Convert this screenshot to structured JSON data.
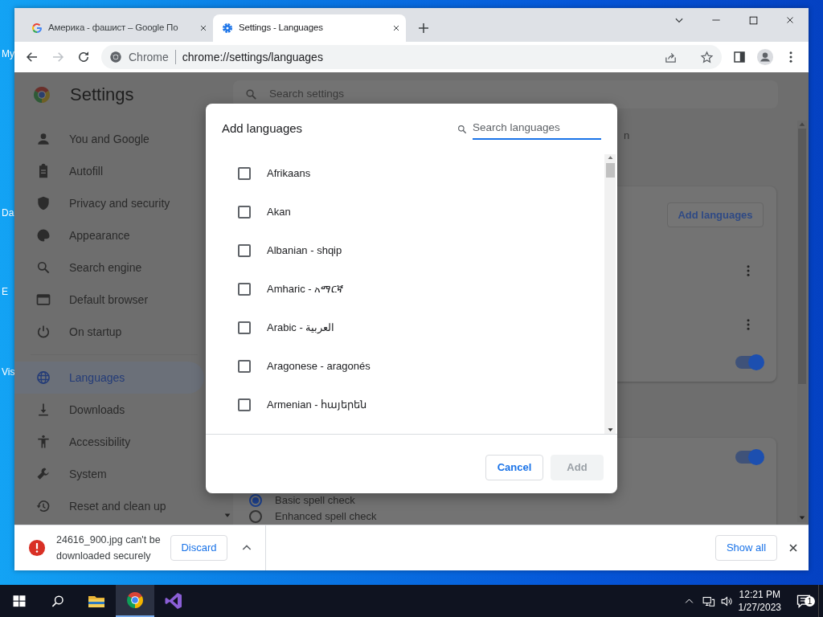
{
  "desktop": {
    "icon_labels": [
      "My",
      "Da",
      "E",
      "Vis"
    ]
  },
  "browser": {
    "tabs": [
      {
        "title": "Америка - фашист – Google По",
        "selected": false
      },
      {
        "title": "Settings - Languages",
        "selected": true
      }
    ],
    "site_chip": "Chrome",
    "url": "chrome://settings/languages"
  },
  "settings": {
    "title": "Settings",
    "search_placeholder": "Search settings",
    "nav_groups": [
      [
        {
          "label": "You and Google",
          "selected": false
        },
        {
          "label": "Autofill",
          "selected": false
        },
        {
          "label": "Privacy and security",
          "selected": false
        },
        {
          "label": "Appearance",
          "selected": false
        },
        {
          "label": "Search engine",
          "selected": false
        },
        {
          "label": "Default browser",
          "selected": false
        },
        {
          "label": "On startup",
          "selected": false
        }
      ],
      [
        {
          "label": "Languages",
          "selected": true
        },
        {
          "label": "Downloads",
          "selected": false
        },
        {
          "label": "Accessibility",
          "selected": false
        },
        {
          "label": "System",
          "selected": false
        },
        {
          "label": "Reset and clean up",
          "selected": false
        }
      ]
    ],
    "fragment": "n",
    "add_languages": "Add languages",
    "toggles": [
      {
        "on": true
      },
      {
        "on": true
      }
    ],
    "spell_check": [
      {
        "label": "Basic spell check",
        "selected": true
      },
      {
        "label": "Enhanced spell check",
        "selected": false
      }
    ]
  },
  "dialog": {
    "title": "Add languages",
    "search_placeholder": "Search languages",
    "languages": [
      {
        "label": "Afrikaans",
        "checked": false
      },
      {
        "label": "Akan",
        "checked": false
      },
      {
        "label": "Albanian - shqip",
        "checked": false
      },
      {
        "label": "Amharic - አማርኛ",
        "checked": false
      },
      {
        "label": "Arabic - العربية",
        "checked": false
      },
      {
        "label": "Aragonese - aragonés",
        "checked": false
      },
      {
        "label": "Armenian - հայերեն",
        "checked": false
      }
    ],
    "buttons": [
      {
        "label": "Cancel",
        "disabled": false
      },
      {
        "label": "Add",
        "disabled": true
      }
    ]
  },
  "download": {
    "message": "24616_900.jpg can't be downloaded securely",
    "discard": "Discard",
    "show_all": "Show all"
  },
  "taskbar": {
    "apps": [
      {
        "active": false
      },
      {
        "active": true
      },
      {
        "active": false
      }
    ],
    "time": "12:21 PM",
    "date": "1/27/2023",
    "notifications": "1"
  }
}
